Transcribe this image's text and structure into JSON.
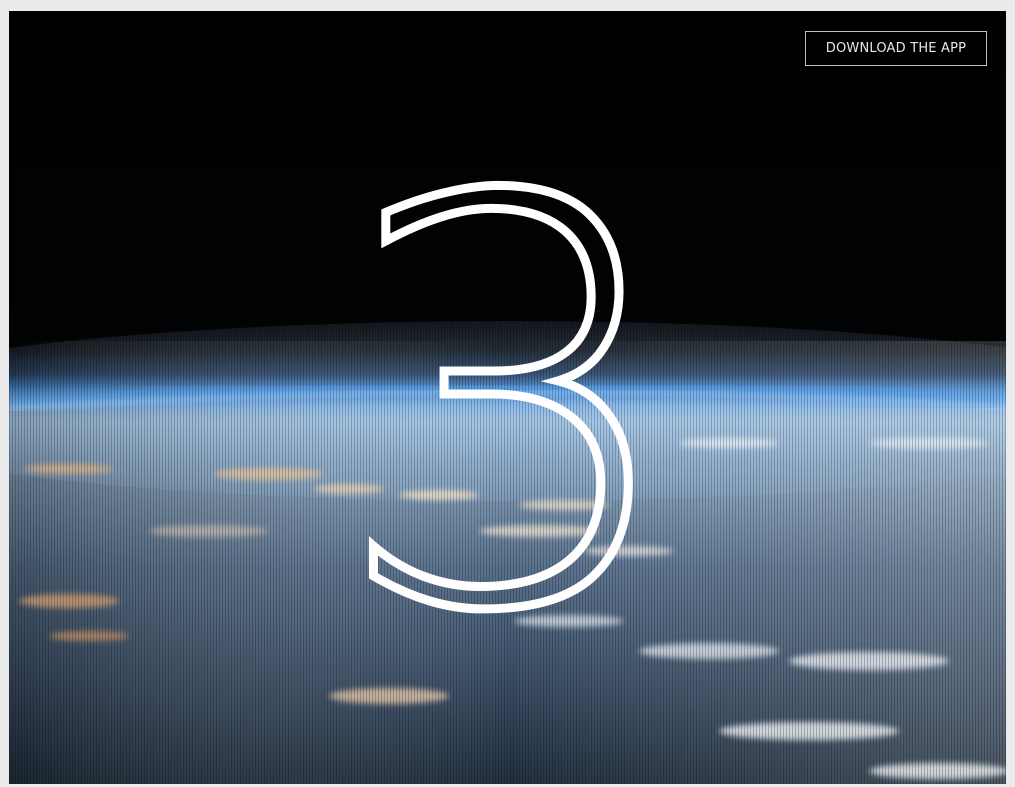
{
  "header": {
    "download_label": "DOWNLOAD THE APP"
  },
  "countdown": {
    "value": "3"
  },
  "colors": {
    "background": "#000000",
    "atmosphere": "#3f8fe0",
    "digit": "#ffffff",
    "button_border": "#ffffff",
    "page_border": "#ebebeb"
  },
  "background": {
    "image": "earth-from-orbit"
  }
}
